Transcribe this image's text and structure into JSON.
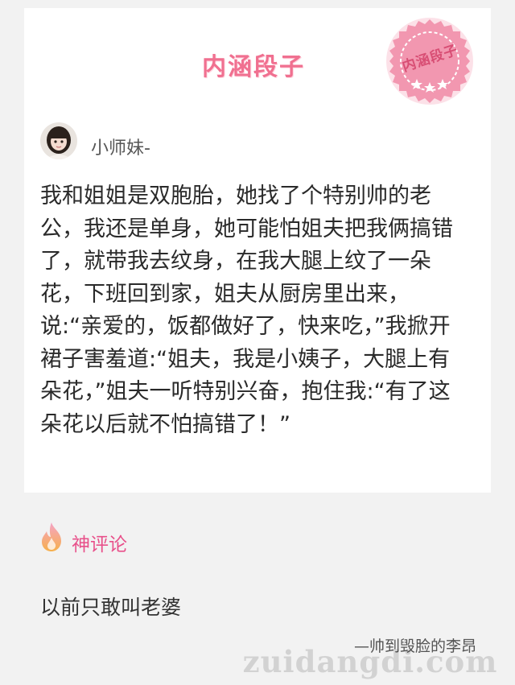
{
  "header": {
    "title": "内涵段子",
    "stamp_text": "内涵段子"
  },
  "post": {
    "username": "小师妹-",
    "text": "我和姐姐是双胞胎，她找了个特别帅的老公，我还是单身，她可能怕姐夫把我俩搞错了，就带我去纹身，在我大腿上纹了一朵花，下班回到家，姐夫从厨房里出来，说:“亲爱的，饭都做好了，快来吃，”我掀开裙子害羞道:“姐夫，我是小姨子，大腿上有朵花，”姐夫一听特别兴奋，抱住我:“有了这朵花以后就不怕搞错了！”"
  },
  "comments": {
    "label": "神评论",
    "icon": "fire-icon",
    "top_comment": {
      "text": "以前只敢叫老婆",
      "author": "—帅到毁脸的李昂"
    }
  },
  "watermark": "zuidangdi.com",
  "colors": {
    "brand_pink": "#f07090",
    "comment_label": "#e8508a",
    "background": "#f2f2f2"
  }
}
